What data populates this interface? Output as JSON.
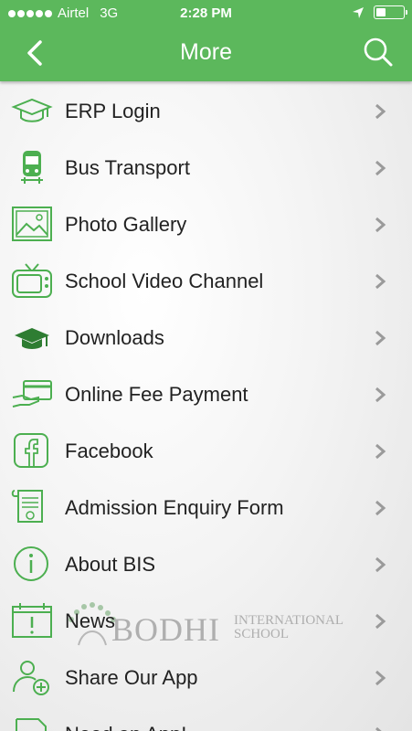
{
  "status_bar": {
    "carrier": "Airtel",
    "network": "3G",
    "time": "2:28 PM"
  },
  "header": {
    "title": "More",
    "back_icon": "chevron-left-icon",
    "search_icon": "search-icon"
  },
  "colors": {
    "header_bg": "#5cb85c",
    "icon_green": "#4caf50",
    "chevron": "#9a9a9a"
  },
  "menu": {
    "items": [
      {
        "label": "ERP Login",
        "icon": "graduation-cap-icon"
      },
      {
        "label": "Bus Transport",
        "icon": "bus-icon"
      },
      {
        "label": "Photo Gallery",
        "icon": "image-icon"
      },
      {
        "label": "School Video Channel",
        "icon": "tv-icon"
      },
      {
        "label": "Downloads",
        "icon": "mortarboard-icon"
      },
      {
        "label": "Online Fee Payment",
        "icon": "card-payment-icon"
      },
      {
        "label": "Facebook",
        "icon": "facebook-icon"
      },
      {
        "label": "Admission Enquiry Form",
        "icon": "scroll-form-icon"
      },
      {
        "label": "About BIS",
        "icon": "info-icon"
      },
      {
        "label": "News",
        "icon": "calendar-alert-icon"
      },
      {
        "label": "Share Our App",
        "icon": "add-user-icon"
      },
      {
        "label": "Need an App!",
        "icon": "app-request-icon"
      }
    ]
  },
  "watermark": {
    "brand": "BODHI",
    "line1": "INTERNATIONAL",
    "line2": "SCHOOL"
  }
}
